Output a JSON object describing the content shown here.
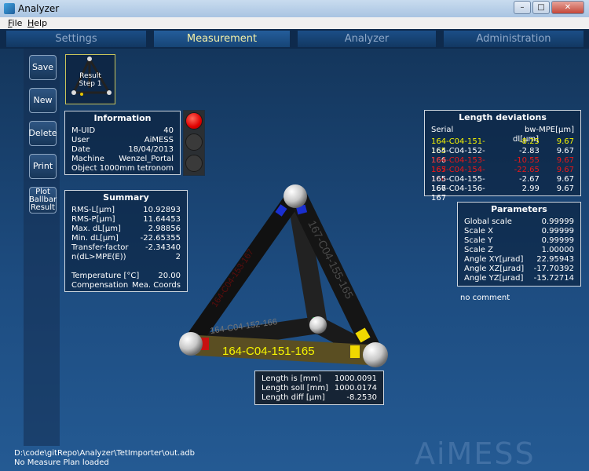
{
  "window": {
    "title": "Analyzer"
  },
  "menu": {
    "file": "File",
    "help": "Help"
  },
  "tabs": [
    {
      "label": "Settings",
      "active": false
    },
    {
      "label": "Measurement",
      "active": true
    },
    {
      "label": "Analyzer",
      "active": false
    },
    {
      "label": "Administration",
      "active": false
    }
  ],
  "sidebar": {
    "save": "Save",
    "new": "New",
    "delete": "Delete",
    "print": "Print",
    "plot_line1": "Plot",
    "plot_line2": "Ballbar",
    "plot_line3": "Result"
  },
  "thumbnail": {
    "line1": "Result",
    "line2": "Step 1"
  },
  "information": {
    "title": "Information",
    "rows": [
      {
        "label": "M-UID",
        "value": "40"
      },
      {
        "label": "User",
        "value": "AiMESS"
      },
      {
        "label": "Date",
        "value": "18/04/2013"
      },
      {
        "label": "Machine",
        "value": "Wenzel_Portal"
      },
      {
        "label": "Object",
        "value": "1000mm tetronom"
      }
    ]
  },
  "traffic_lights": {
    "active": "red",
    "colors": {
      "red": "#e00000",
      "off": "#3a3a3a"
    }
  },
  "summary": {
    "title": "Summary",
    "rows": [
      {
        "label": "RMS-L[µm]",
        "value": "10.92893"
      },
      {
        "label": "RMS-P[µm]",
        "value": "11.64453"
      },
      {
        "label": "Max. dL[µm]",
        "value": "2.98856"
      },
      {
        "label": "Min. dL[µm]",
        "value": "-22.65355"
      },
      {
        "label": "Transfer-factor",
        "value": "-2.34340"
      },
      {
        "label": "n(dL>MPE(E))",
        "value": "2"
      }
    ],
    "rows2": [
      {
        "label": "Temperature [°C]",
        "value": "20.00"
      },
      {
        "label": "Compensation",
        "value": "Mea. Coords"
      }
    ]
  },
  "length_deviations": {
    "title": "Length deviations",
    "headers": {
      "serial": "Serial",
      "bw": "bw-dl[µm]",
      "mpe": "MPE[µm]"
    },
    "rows": [
      {
        "serial": "164-C04-151-165",
        "bw": "-8.25",
        "mpe": "9.67",
        "status": "selected"
      },
      {
        "serial": "164-C04-152-166",
        "bw": "-2.83",
        "mpe": "9.67",
        "status": "ok"
      },
      {
        "serial": "164-C04-153-167",
        "bw": "-10.55",
        "mpe": "9.67",
        "status": "fail"
      },
      {
        "serial": "165-C04-154-166",
        "bw": "-22.65",
        "mpe": "9.67",
        "status": "fail"
      },
      {
        "serial": "165-C04-155-167",
        "bw": "-2.67",
        "mpe": "9.67",
        "status": "ok"
      },
      {
        "serial": "166-C04-156-167",
        "bw": "2.99",
        "mpe": "9.67",
        "status": "ok"
      }
    ]
  },
  "parameters": {
    "title": "Parameters",
    "rows": [
      {
        "label": "Global scale",
        "value": "0.99999"
      },
      {
        "label": "Scale X",
        "value": "0.99999"
      },
      {
        "label": "Scale Y",
        "value": "0.99999"
      },
      {
        "label": "Scale Z",
        "value": "1.00000"
      },
      {
        "label": "Angle XY[µrad]",
        "value": "22.95943"
      },
      {
        "label": "Angle XZ[µrad]",
        "value": "-17.70392"
      },
      {
        "label": "Angle YZ[µrad]",
        "value": "-15.72714"
      }
    ]
  },
  "comment": "no comment",
  "tetrahedron": {
    "bar_labels": {
      "front": "164-C04-151-165",
      "middle": "164-C04-152-166",
      "left": "164-C04-153-167",
      "right": "167-C04-155-165"
    }
  },
  "length_info": {
    "rows": [
      {
        "label": "Length is [mm]",
        "value": "1000.0091"
      },
      {
        "label": "Length soll [mm]",
        "value": "1000.0174"
      },
      {
        "label": "Length diff [µm]",
        "value": "-8.2530"
      }
    ]
  },
  "status": {
    "path": "D:\\code\\gitRepo\\Analyzer\\TetImporter\\out.adb",
    "plan": "No Measure Plan loaded"
  },
  "logo_text": "AiMESS",
  "colors": {
    "highlight": "#f6f500",
    "fail": "#e81818",
    "tab_active": "#f4f0a8"
  }
}
